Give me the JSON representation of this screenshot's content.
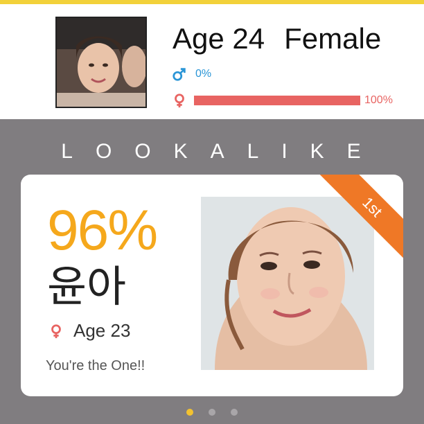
{
  "profile": {
    "age_text": "Age 24",
    "gender_text": "Female",
    "male_percent_label": "0%",
    "female_percent_label": "100%",
    "male_percent": 0,
    "female_percent": 100
  },
  "lookalike": {
    "title": "LOOKALIKE",
    "score": "96%",
    "name": "윤아",
    "age_text": "Age 23",
    "tagline": "You're the One!!",
    "rank_badge": "1st"
  },
  "pager": {
    "count": 3,
    "active_index": 0
  },
  "colors": {
    "male": "#2a95d6",
    "female": "#e86462",
    "score": "#f5a81c",
    "ribbon": "#ef7826",
    "panel_bg": "#807d80",
    "accent_strip": "#f2d13a"
  },
  "icons": {
    "male": "male-symbol-icon",
    "female": "female-symbol-icon"
  }
}
